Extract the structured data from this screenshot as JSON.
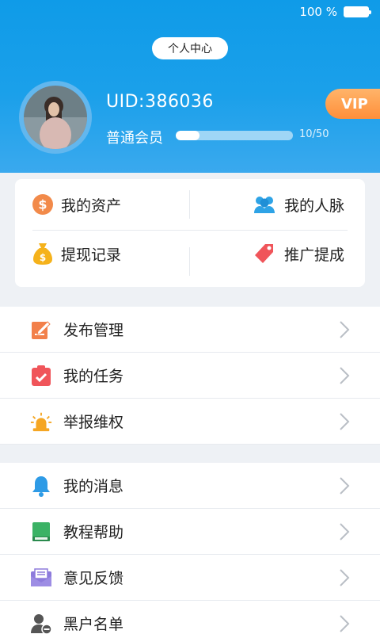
{
  "status_bar": {
    "battery_percent": "100 %"
  },
  "header": {
    "title": "个人中心",
    "uid": "UID:386036",
    "level_label": "普通会员",
    "progress_text": "10/50",
    "progress_fraction": 0.2,
    "vip_label": "VIP"
  },
  "quick_actions": [
    {
      "label": "我的资产",
      "icon": "dollar-coin-icon",
      "color": "#f28a4a"
    },
    {
      "label": "我的人脉",
      "icon": "people-icon",
      "color": "#2ea3e6"
    },
    {
      "label": "提现记录",
      "icon": "money-bag-icon",
      "color": "#f5b21b"
    },
    {
      "label": "推广提成",
      "icon": "price-tag-icon",
      "color": "#f0555a"
    }
  ],
  "menu_group_1": [
    {
      "label": "发布管理",
      "icon": "edit-document-icon",
      "color": "#f2804a"
    },
    {
      "label": "我的任务",
      "icon": "task-clipboard-icon",
      "color": "#f0555a"
    },
    {
      "label": "举报维权",
      "icon": "alarm-light-icon",
      "color": "#f5a623"
    }
  ],
  "menu_group_2": [
    {
      "label": "我的消息",
      "icon": "bell-icon",
      "color": "#2e9be6"
    },
    {
      "label": "教程帮助",
      "icon": "book-icon",
      "color": "#3bb265"
    },
    {
      "label": "意见反馈",
      "icon": "mail-icon",
      "color": "#8d7bdc"
    },
    {
      "label": "黑户名单",
      "icon": "user-block-icon",
      "color": "#555555"
    }
  ]
}
